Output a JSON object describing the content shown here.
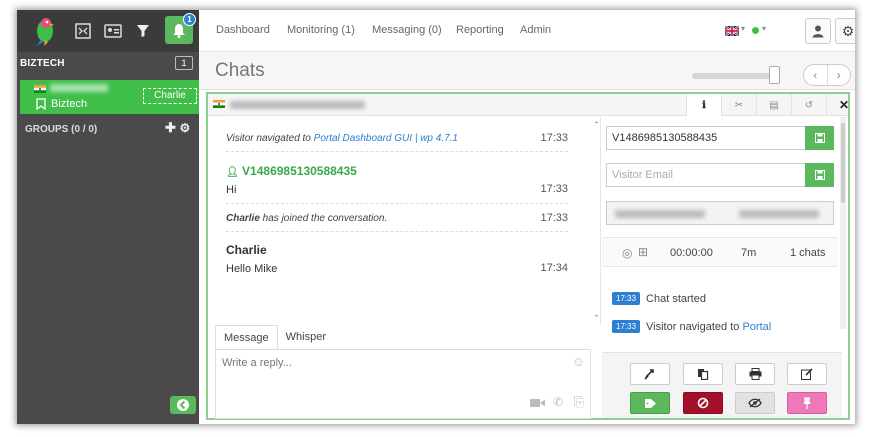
{
  "sidebar": {
    "org_name": "BIZTECH",
    "org_count": "1",
    "notifications_badge": "1",
    "active_visitor": {
      "name": "Biztech",
      "agent": "Charlie"
    },
    "groups_label": "GROUPS (0 / 0)"
  },
  "nav": {
    "items": [
      "Dashboard",
      "Monitoring (1)",
      "Messaging (0)",
      "Reporting",
      "Admin"
    ]
  },
  "page": {
    "title": "Chats"
  },
  "chat": {
    "tabs": [
      "info",
      "scissors",
      "book",
      "history",
      "close"
    ],
    "messages": {
      "m1_prefix": "Visitor navigated to ",
      "m1_link": "Portal Dashboard GUI | wp 4.7.1",
      "m1_time": "17:33",
      "m2_name": "V1486985130588435",
      "m2_text": "Hi",
      "m2_time": "17:33",
      "m3_name": "Charlie",
      "m3_suffix": " has joined the conversation.",
      "m3_time": "17:33",
      "m4_name": "Charlie",
      "m4_text": "Hello Mike",
      "m4_time": "17:34"
    },
    "compose": {
      "tab_message": "Message",
      "tab_whisper": "Whisper",
      "placeholder": "Write a reply..."
    }
  },
  "visitor": {
    "id": "V1486985130588435",
    "email_placeholder": "Visitor Email",
    "duration": "00:00:00",
    "time_on_site": "7m",
    "chats": "1 chats",
    "events": [
      {
        "time": "17:33",
        "text": "Chat started",
        "link": ""
      },
      {
        "time": "17:33",
        "text": "Visitor navigated to ",
        "link": "Portal"
      }
    ]
  },
  "colors": {
    "accent_green": "#5cb85c",
    "visitor_green": "#3fbf4a",
    "link_blue": "#2d7fd1",
    "danger": "#a4102a",
    "pin_pink": "#ef78b8",
    "sidebar": "#4a4a4a"
  }
}
